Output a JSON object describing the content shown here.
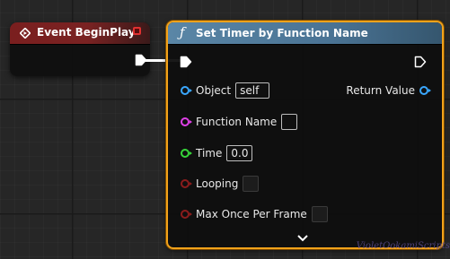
{
  "event_node": {
    "title": "Event BeginPlay",
    "icon": "event-diamond-icon",
    "header_color": "#7a1f1f",
    "delegate_pin_color": "#e03030"
  },
  "timer_node": {
    "title": "Set Timer by Function Name",
    "icon": "function-icon",
    "header_color": "#4a7394",
    "selected_border_color": "#f2a21a",
    "pins": {
      "object": {
        "label": "Object",
        "value": "self",
        "color": "#3aa8ff"
      },
      "function_name": {
        "label": "Function Name",
        "value": "",
        "color": "#e040e8"
      },
      "time": {
        "label": "Time",
        "value": "0.0",
        "color": "#37d63a"
      },
      "looping": {
        "label": "Looping",
        "color": "#8b1c1c"
      },
      "max_once_per_frame": {
        "label": "Max Once Per Frame",
        "color": "#8b1c1c"
      },
      "return_value": {
        "label": "Return Value",
        "color": "#3aa8ff"
      }
    },
    "expand_icon": "chevron-down-icon"
  },
  "watermark": "VioletOokamiScripts"
}
